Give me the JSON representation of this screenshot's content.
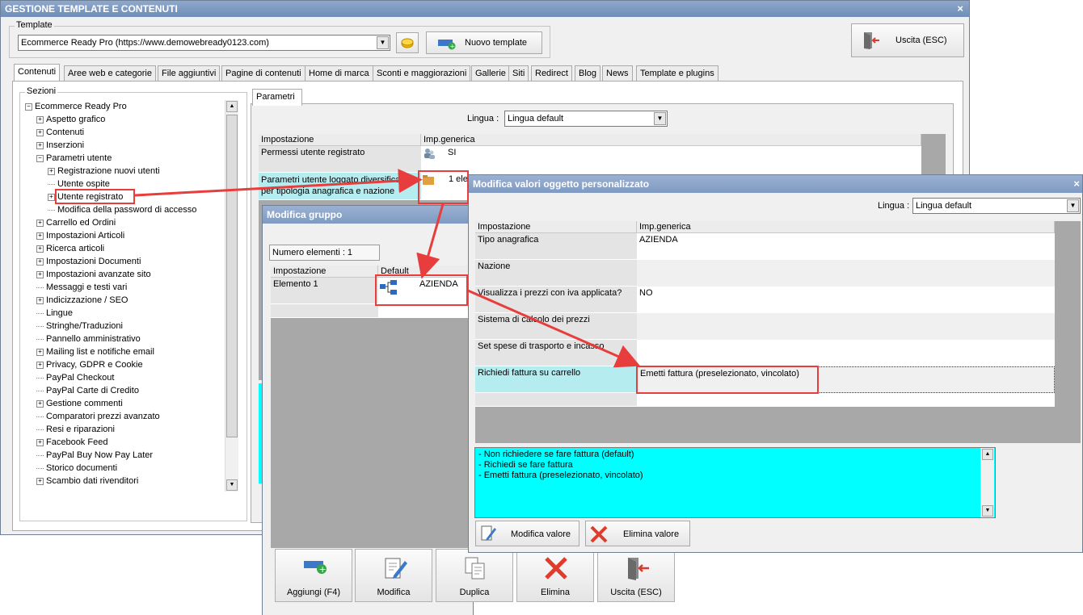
{
  "main_window": {
    "title": "GESTIONE TEMPLATE E CONTENUTI",
    "close": "×",
    "template_group_label": "Template",
    "template_combo_value": "Ecommerce Ready Pro (https://www.demowebready0123.com)",
    "new_template_label": "Nuovo template",
    "exit_label": "Uscita (ESC)",
    "tabs": [
      "Contenuti",
      "Aree web e categorie",
      "File aggiuntivi",
      "Pagine di contenuti",
      "Home di marca",
      "Sconti e maggiorazioni",
      "Gallerie",
      "Siti",
      "Redirect",
      "Blog",
      "News",
      "Template e plugins"
    ],
    "sections_label": "Sezioni",
    "tree": [
      {
        "label": "Ecommerce Ready Pro",
        "level": 0,
        "marker": "minus"
      },
      {
        "label": "Aspetto grafico",
        "level": 1,
        "marker": "plus"
      },
      {
        "label": "Contenuti",
        "level": 1,
        "marker": "plus"
      },
      {
        "label": "Inserzioni",
        "level": 1,
        "marker": "plus"
      },
      {
        "label": "Parametri utente",
        "level": 1,
        "marker": "minus"
      },
      {
        "label": "Registrazione nuovi utenti",
        "level": 2,
        "marker": "plus"
      },
      {
        "label": "Utente ospite",
        "level": 2,
        "marker": "dot"
      },
      {
        "label": "Utente registrato",
        "level": 2,
        "marker": "plus"
      },
      {
        "label": "Modifica della password di accesso",
        "level": 2,
        "marker": "dot"
      },
      {
        "label": "Carrello ed Ordini",
        "level": 1,
        "marker": "plus"
      },
      {
        "label": "Impostazioni Articoli",
        "level": 1,
        "marker": "plus"
      },
      {
        "label": "Ricerca articoli",
        "level": 1,
        "marker": "plus"
      },
      {
        "label": "Impostazioni Documenti",
        "level": 1,
        "marker": "plus"
      },
      {
        "label": "Impostazioni avanzate sito",
        "level": 1,
        "marker": "plus"
      },
      {
        "label": "Messaggi e testi vari",
        "level": 1,
        "marker": "dot"
      },
      {
        "label": "Indicizzazione / SEO",
        "level": 1,
        "marker": "plus"
      },
      {
        "label": "Lingue",
        "level": 1,
        "marker": "dot"
      },
      {
        "label": "Stringhe/Traduzioni",
        "level": 1,
        "marker": "dot"
      },
      {
        "label": "Pannello amministrativo",
        "level": 1,
        "marker": "dot"
      },
      {
        "label": "Mailing list e notifiche email",
        "level": 1,
        "marker": "plus"
      },
      {
        "label": "Privacy, GDPR e Cookie",
        "level": 1,
        "marker": "plus"
      },
      {
        "label": "PayPal Checkout",
        "level": 1,
        "marker": "dot"
      },
      {
        "label": "PayPal Carte di Credito",
        "level": 1,
        "marker": "dot"
      },
      {
        "label": "Gestione commenti",
        "level": 1,
        "marker": "plus"
      },
      {
        "label": "Comparatori prezzi avanzato",
        "level": 1,
        "marker": "dot"
      },
      {
        "label": "Resi e riparazioni",
        "level": 1,
        "marker": "dot"
      },
      {
        "label": "Facebook Feed",
        "level": 1,
        "marker": "plus"
      },
      {
        "label": "PayPal Buy Now Pay Later",
        "level": 1,
        "marker": "dot"
      },
      {
        "label": "Storico documenti",
        "level": 1,
        "marker": "dot"
      },
      {
        "label": "Scambio dati rivenditori",
        "level": 1,
        "marker": "plus"
      }
    ],
    "params_tab": "Parametri",
    "lingua_label": "Lingua :",
    "lingua_value": "Lingua default",
    "grid_head_setting": "Impostazione",
    "grid_head_value": "Imp.generica",
    "row1_label": "Permessi utente registrato",
    "row1_value": "SI",
    "row2_label": "Parametri utente loggato diversificati per tipologia anagrafica e nazione",
    "row2_value": "1 ele"
  },
  "group_window": {
    "title": "Modifica gruppo",
    "count_label": "Numero elementi : 1",
    "head_setting": "Impostazione",
    "head_default": "Default",
    "row_label": "Elemento 1",
    "row_value": "AZIENDA",
    "buttons": [
      "Aggiungi (F4)",
      "Modifica",
      "Duplica",
      "Elimina",
      "Uscita (ESC)"
    ]
  },
  "custom_window": {
    "title": "Modifica valori oggetto personalizzato",
    "close": "×",
    "lingua_label": "Lingua :",
    "lingua_value": "Lingua default",
    "head_setting": "Impostazione",
    "head_value": "Imp.generica",
    "rows": [
      {
        "label": "Tipo anagrafica",
        "value": "AZIENDA"
      },
      {
        "label": "Nazione",
        "value": ""
      },
      {
        "label": "Visualizza i prezzi con iva applicata?",
        "value": "NO"
      },
      {
        "label": "Sistema di calcolo dei prezzi",
        "value": ""
      },
      {
        "label": "Set spese di trasporto e incasso",
        "value": ""
      },
      {
        "label": "Richiedi fattura su carrello",
        "value": "Emetti fattura (preselezionato, vincolato)"
      }
    ],
    "options": [
      "- Non richiedere se fare fattura (default)",
      "- Richiedi se fare fattura",
      "- Emetti fattura (preselezionato, vincolato)"
    ],
    "edit_value_label": "Modifica valore",
    "delete_value_label": "Elimina valore"
  },
  "colors": {
    "highlight_row": "#b4ecf0",
    "options_bg": "#00ffff",
    "annotation": "#e83d3d",
    "title_gradient": "#7f9ac2"
  }
}
